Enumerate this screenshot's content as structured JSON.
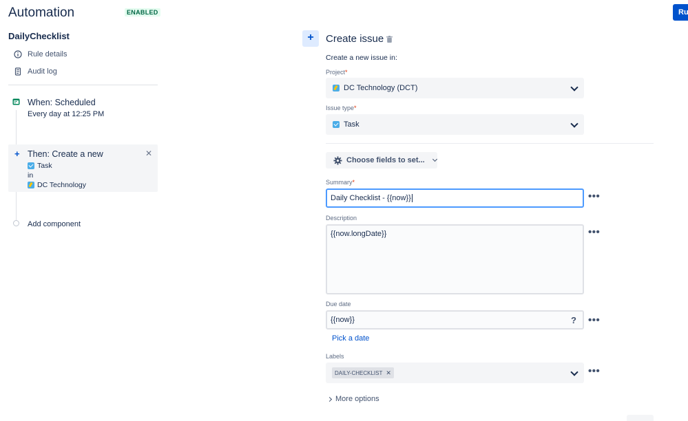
{
  "header": {
    "title": "Automation",
    "status_badge": "ENABLED",
    "top_right_button": "Ru"
  },
  "sidebar": {
    "rule_name": "DailyChecklist",
    "links": [
      {
        "label": "Rule details",
        "icon": "info-icon"
      },
      {
        "label": "Audit log",
        "icon": "audit-log-icon"
      }
    ],
    "trigger": {
      "title": "When: Scheduled",
      "subtitle": "Every day at 12:25 PM",
      "icon": "calendar-icon"
    },
    "action": {
      "title": "Then: Create a new",
      "issue_type": "Task",
      "in_label": "in",
      "project": "DC Technology"
    },
    "add_component": "Add component"
  },
  "panel": {
    "title": "Create issue",
    "intro": "Create a new issue in:",
    "project": {
      "label": "Project",
      "value": "DC Technology (DCT)"
    },
    "issue_type": {
      "label": "Issue type",
      "value": "Task"
    },
    "choose_fields": "Choose fields to set...",
    "summary": {
      "label": "Summary",
      "value": "Daily Checklist - {{now}}"
    },
    "description": {
      "label": "Description",
      "value": "{{now.longDate}}"
    },
    "due_date": {
      "label": "Due date",
      "value": "{{now}}",
      "help": "?"
    },
    "pick_date": "Pick a date",
    "labels": {
      "label": "Labels",
      "tags": [
        "DAILY-CHECKLIST"
      ]
    },
    "more_options": "More options",
    "more_actions": "•••",
    "required_mark": "*"
  },
  "colors": {
    "primary": "#0052cc",
    "text": "#172b4d",
    "subtle": "#5e6c84",
    "enabled_green": "#006644",
    "focus": "#4c9aff",
    "required": "#de350b"
  }
}
